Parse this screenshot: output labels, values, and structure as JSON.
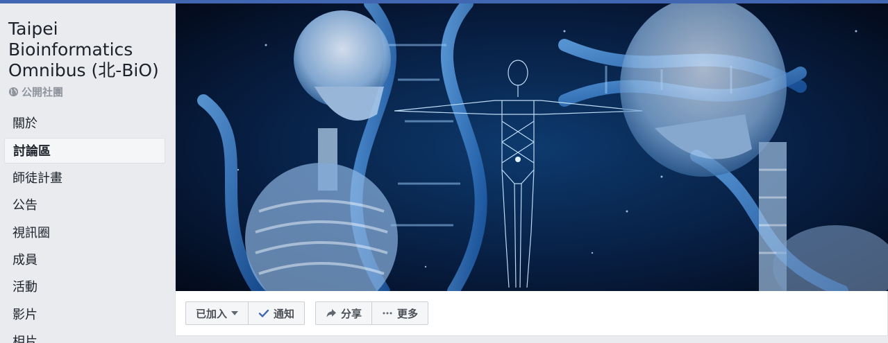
{
  "group": {
    "title": "Taipei Bioinformatics Omnibus (北-BiO)",
    "privacy": "公開社團",
    "privacy_icon": "globe-icon"
  },
  "sidebar": {
    "items": [
      {
        "label": "關於",
        "active": false
      },
      {
        "label": "討論區",
        "active": true
      },
      {
        "label": "師徒計畫",
        "active": false
      },
      {
        "label": "公告",
        "active": false
      },
      {
        "label": "視訊圈",
        "active": false
      },
      {
        "label": "成員",
        "active": false
      },
      {
        "label": "活動",
        "active": false
      },
      {
        "label": "影片",
        "active": false
      },
      {
        "label": "相片",
        "active": false
      }
    ]
  },
  "actions": {
    "joined": "已加入",
    "notify": "通知",
    "share": "分享",
    "more": "更多"
  },
  "colors": {
    "accent": "#4267b2",
    "check": "#4267b2",
    "page_bg": "#e9ebee"
  }
}
